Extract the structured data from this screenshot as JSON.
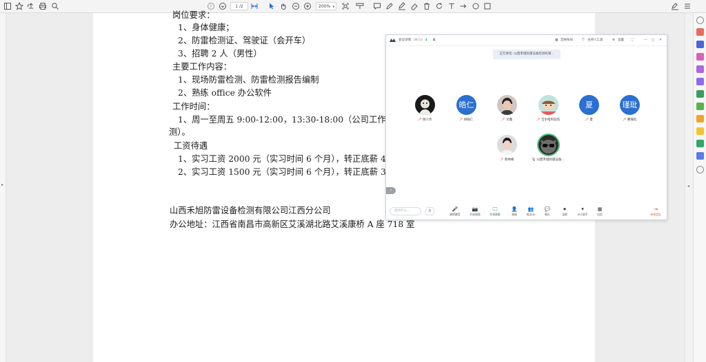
{
  "toolbar": {
    "left_icons": [
      "panel-icon",
      "bookmark-star-icon",
      "upload-icon",
      "print-icon",
      "search-icon"
    ],
    "page_current": "1",
    "page_total": "/2",
    "zoom": "200%"
  },
  "document": {
    "lines": [
      "岗位要求：",
      "1、身体健康；",
      "2、防雷检测证、驾驶证（会开车）",
      "3、招聘 2 人（男性）",
      "主要工作内容：",
      "1、现场防雷检测、防雷检测报告编制",
      "2、熟练 office 办公软件",
      "工作时间：",
      "1、周一至周五 9:00-12:00，13:30-18:00（公司工作轻",
      "测）。",
      "工资待遇",
      "1、实习工资 2000 元（实习时间 6 个月），转正底薪 4",
      "2、实习工资 1500 元（实习时间 6 个月），转正底薪 3",
      "山西禾旭防雷设备检测有限公司江西分公司",
      "办公地址：江西省南昌市高新区艾溪湖北路艾溪康桥 A 座 718 室"
    ]
  },
  "meeting": {
    "app_name": "会议详情",
    "timer": "08:53",
    "layout_label": "宫格布局",
    "host_label": "主持人工具",
    "settings_label": "设置",
    "toast": "正在讲话: 山西禾旭防雷设备检测有限...",
    "participants": [
      {
        "name": "杨少玲",
        "avatar_text": "",
        "kind": "photo-dark"
      },
      {
        "name": "杨皓仁",
        "avatar_text": "皓仁",
        "kind": "text"
      },
      {
        "name": "文鑫",
        "avatar_text": "",
        "kind": "photo-face"
      },
      {
        "name": "吉尔哈利勃克",
        "avatar_text": "",
        "kind": "photo-cartoon"
      },
      {
        "name": "夏",
        "avatar_text": "夏",
        "kind": "text"
      },
      {
        "name": "瞿璀玭",
        "avatar_text": "瑾玭",
        "kind": "text"
      },
      {
        "name": "蔡林峰",
        "avatar_text": "",
        "kind": "photo-face"
      },
      {
        "name": "山西禾旭防雷设备...",
        "avatar_text": "",
        "kind": "photo-cat"
      }
    ],
    "chat_placeholder": "说点什么...",
    "toolbar": [
      {
        "label": "解除静音",
        "glyph": "🎤"
      },
      {
        "label": "开启视频",
        "glyph": "📷"
      },
      {
        "label": "共享屏幕",
        "glyph": "🖵"
      },
      {
        "label": "邀请",
        "glyph": "👤"
      },
      {
        "label": "成员(8)",
        "glyph": "👥"
      },
      {
        "label": "聊天",
        "glyph": "💬"
      },
      {
        "label": "录制",
        "glyph": "⏺"
      },
      {
        "label": "AI小助手",
        "glyph": "✦"
      },
      {
        "label": "应用",
        "glyph": "▦"
      }
    ],
    "end_label": "结束会议"
  },
  "colors": {
    "accent_blue": "#2a6fd1",
    "end_red": "#e0533a",
    "active_green": "#4bc47a"
  }
}
